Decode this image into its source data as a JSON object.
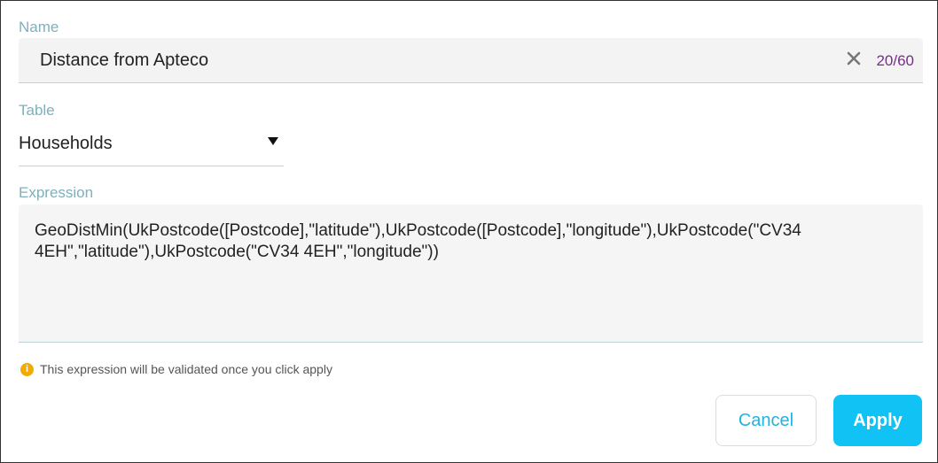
{
  "form": {
    "name_label": "Name",
    "name_value": "Distance from Apteco",
    "name_count": "20/60",
    "table_label": "Table",
    "table_value": "Households",
    "expression_label": "Expression",
    "expression_value": "GeoDistMin(UkPostcode([Postcode],\"latitude\"),UkPostcode([Postcode],\"longitude\"),UkPostcode(\"CV34 4EH\",\"latitude\"),UkPostcode(\"CV34 4EH\",\"longitude\"))",
    "hint": "This expression will be validated once you click apply",
    "hint_icon": "info-icon",
    "clear_icon": "close-icon",
    "dropdown_icon": "caret-down-icon"
  },
  "actions": {
    "cancel_label": "Cancel",
    "apply_label": "Apply"
  },
  "colors": {
    "label": "#7fb0bb",
    "counter": "#7a2a8c",
    "accent": "#11c3f5",
    "cancel_text": "#1fb4e0",
    "info": "#f0ac00"
  }
}
